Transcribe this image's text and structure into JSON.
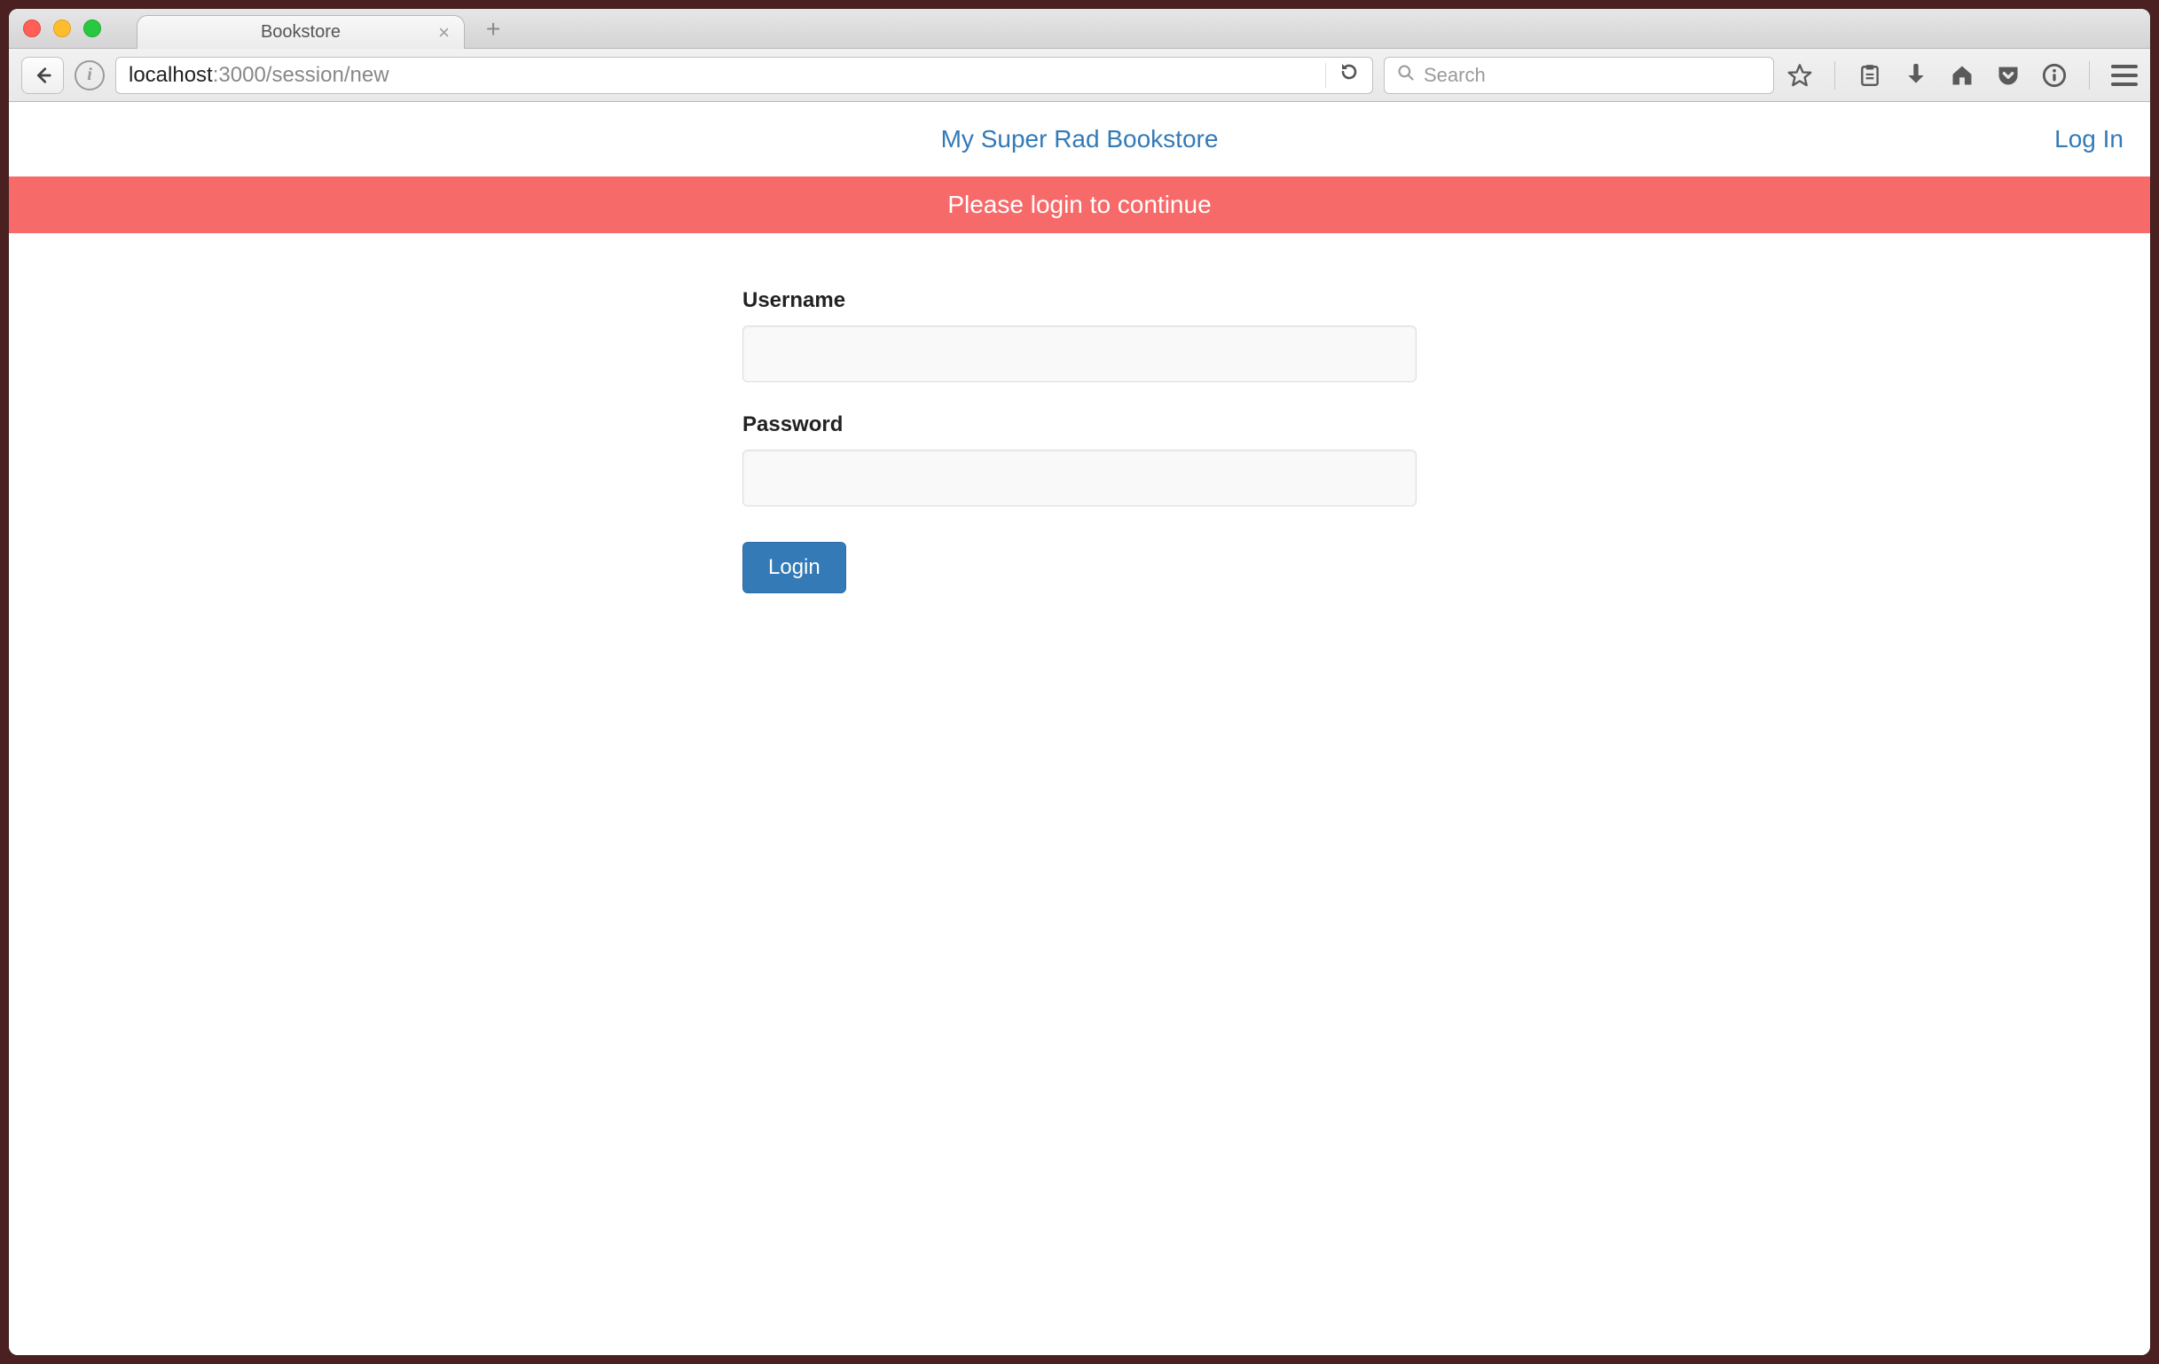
{
  "browser": {
    "tab_title": "Bookstore",
    "url_host": "localhost",
    "url_rest": ":3000/session/new",
    "search_placeholder": "Search"
  },
  "page": {
    "brand": "My Super Rad Bookstore",
    "login_link": "Log In",
    "flash": "Please login to continue",
    "form": {
      "username_label": "Username",
      "username_value": "",
      "password_label": "Password",
      "password_value": "",
      "submit_label": "Login"
    }
  }
}
